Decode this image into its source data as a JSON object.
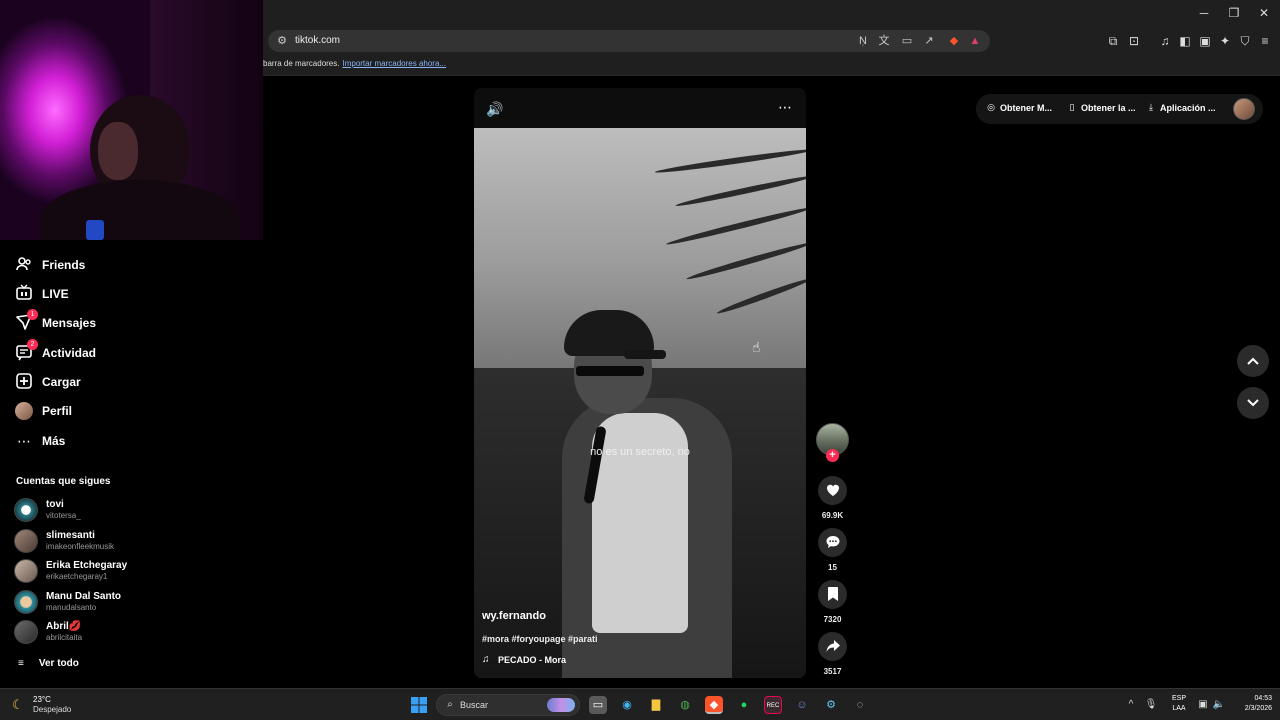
{
  "browser": {
    "url": "tiktok.com",
    "bookmarks_text": "barra de marcadores.",
    "bookmarks_link": "Importar marcadores ahora..."
  },
  "sidebar": {
    "items": [
      {
        "label": "Friends",
        "icon": "friends-icon"
      },
      {
        "label": "LIVE",
        "icon": "live-icon"
      },
      {
        "label": "Mensajes",
        "icon": "messages-icon",
        "badge": "1"
      },
      {
        "label": "Actividad",
        "icon": "activity-icon",
        "badge": "2"
      },
      {
        "label": "Cargar",
        "icon": "upload-icon"
      },
      {
        "label": "Perfil",
        "icon": "profile-avatar"
      },
      {
        "label": "Más",
        "icon": "more-icon"
      }
    ],
    "following_title": "Cuentas que sigues",
    "following": [
      {
        "name": "tovi",
        "user": "vitotersa_"
      },
      {
        "name": "slimesanti",
        "user": "imakeonfleekmusik"
      },
      {
        "name": "Erika Etchegaray",
        "user": "erikaetchegaray1"
      },
      {
        "name": "Manu Dal Santo",
        "user": "manudalsanto"
      },
      {
        "name": "Abril💋",
        "user": "abrilcitaita"
      }
    ],
    "see_all": "Ver todo"
  },
  "video": {
    "caption": "no es un secreto, no",
    "author": "wy.fernando",
    "tags": "#mora #foryoupage #parati",
    "music": "PECADO - Mora"
  },
  "actions": {
    "likes": "69.9K",
    "comments": "15",
    "saves": "7320",
    "shares": "3517"
  },
  "header": {
    "pill": [
      "Obtener M...",
      "Obtener la ...",
      "Aplicación ..."
    ]
  },
  "taskbar": {
    "temp": "23°C",
    "weather": "Despejado",
    "search": "Buscar",
    "lang_top": "ESP",
    "lang_bottom": "LAA",
    "time": "04:53",
    "date": "2/3/2026"
  },
  "colors": {
    "accent": "#fe2c55",
    "background": "#000000"
  }
}
